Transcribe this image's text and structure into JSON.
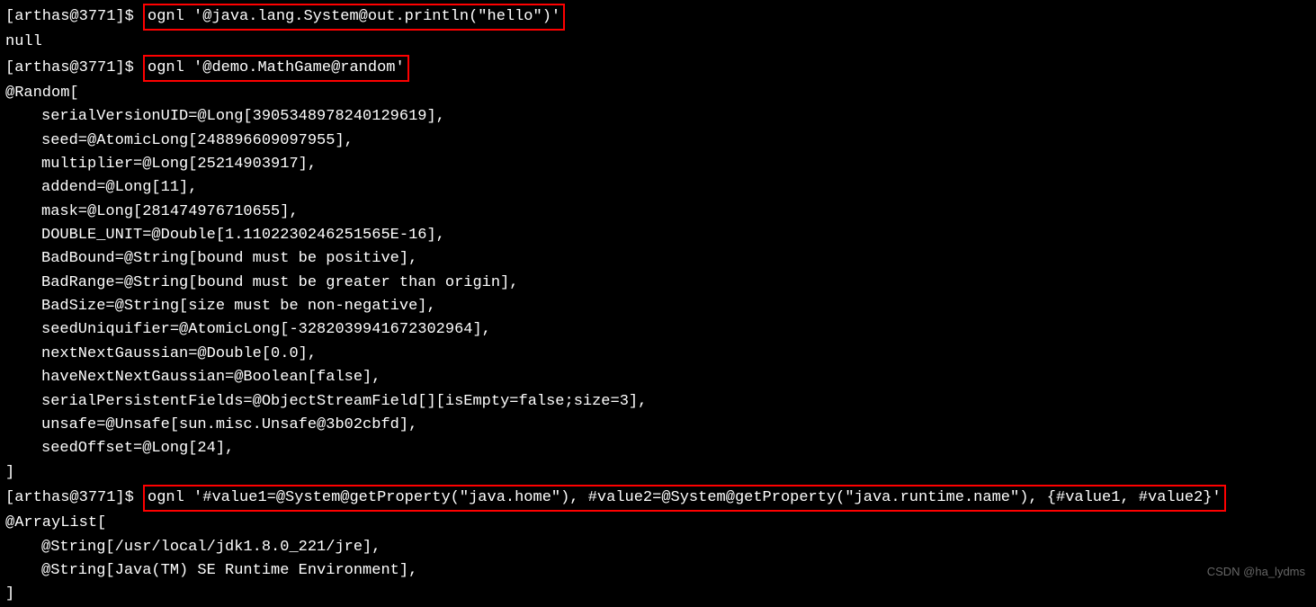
{
  "prompt": "[arthas@3771]$ ",
  "cmd1": "ognl '@java.lang.System@out.println(\"hello\")'",
  "out1": "null",
  "cmd2": "ognl '@demo.MathGame@random'",
  "out2_header": "@Random[",
  "out2_fields": [
    "serialVersionUID=@Long[3905348978240129619],",
    "seed=@AtomicLong[248896609097955],",
    "multiplier=@Long[25214903917],",
    "addend=@Long[11],",
    "mask=@Long[281474976710655],",
    "DOUBLE_UNIT=@Double[1.1102230246251565E-16],",
    "BadBound=@String[bound must be positive],",
    "BadRange=@String[bound must be greater than origin],",
    "BadSize=@String[size must be non-negative],",
    "seedUniquifier=@AtomicLong[-3282039941672302964],",
    "nextNextGaussian=@Double[0.0],",
    "haveNextNextGaussian=@Boolean[false],",
    "serialPersistentFields=@ObjectStreamField[][isEmpty=false;size=3],",
    "unsafe=@Unsafe[sun.misc.Unsafe@3b02cbfd],",
    "seedOffset=@Long[24],"
  ],
  "out2_footer": "]",
  "cmd3": "ognl '#value1=@System@getProperty(\"java.home\"), #value2=@System@getProperty(\"java.runtime.name\"), {#value1, #value2}'",
  "out3_header": "@ArrayList[",
  "out3_fields": [
    "@String[/usr/local/jdk1.8.0_221/jre],",
    "@String[Java(TM) SE Runtime Environment],"
  ],
  "out3_footer": "]",
  "watermark": "CSDN @ha_lydms"
}
